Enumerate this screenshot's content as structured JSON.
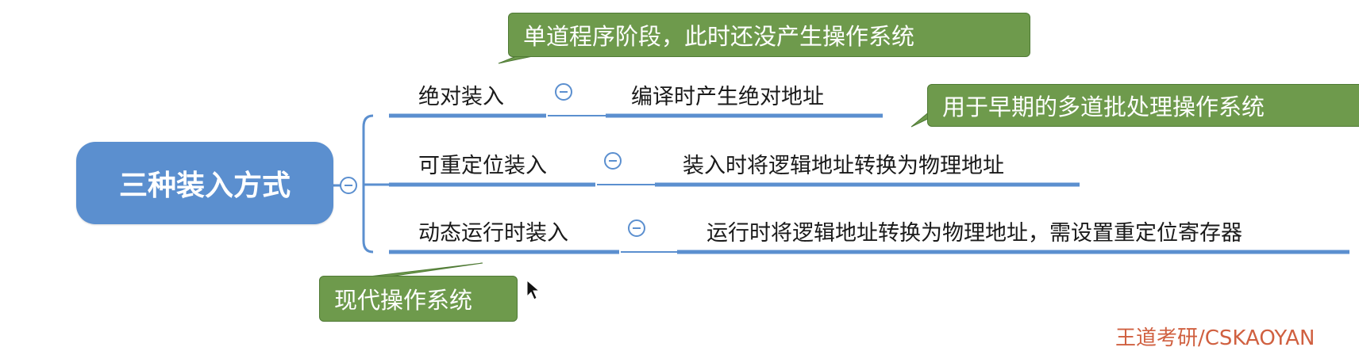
{
  "root": {
    "label": "三种装入方式"
  },
  "branches": [
    {
      "label": "绝对装入",
      "detail": "编译时产生绝对地址"
    },
    {
      "label": "可重定位装入",
      "detail": "装入时将逻辑地址转换为物理地址"
    },
    {
      "label": "动态运行时装入",
      "detail": "运行时将逻辑地址转换为物理地址，需设置重定位寄存器"
    }
  ],
  "callouts": [
    {
      "text": "单道程序阶段，此时还没产生操作系统"
    },
    {
      "text": "用于早期的多道批处理操作系统"
    },
    {
      "text": "现代操作系统"
    }
  ],
  "watermark": "王道考研/CSKAOYAN",
  "colors": {
    "node": "#5b8fcf",
    "line": "#5b8fcf",
    "callout": "#6e9a4c"
  }
}
